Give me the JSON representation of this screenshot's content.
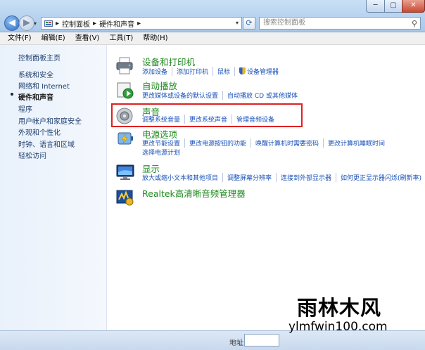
{
  "window": {
    "min_glyph": "─",
    "max_glyph": "▢",
    "close_glyph": "✕"
  },
  "address": {
    "crumbs": [
      "控制面板",
      "硬件和声音"
    ],
    "separator": "▸"
  },
  "search": {
    "placeholder": "搜索控制面板"
  },
  "menubar": [
    "文件(F)",
    "编辑(E)",
    "查看(V)",
    "工具(T)",
    "帮助(H)"
  ],
  "sidebar": {
    "items": [
      {
        "label": "控制面板主页"
      },
      {
        "label": "系统和安全"
      },
      {
        "label": "网络和 Internet"
      },
      {
        "label": "硬件和声音",
        "active": true
      },
      {
        "label": "程序"
      },
      {
        "label": "用户帐户和家庭安全"
      },
      {
        "label": "外观和个性化"
      },
      {
        "label": "时钟、语言和区域"
      },
      {
        "label": "轻松访问"
      }
    ]
  },
  "categories": [
    {
      "title": "设备和打印机",
      "icon": "printer-icon",
      "links": [
        [
          "添加设备",
          "添加打印机",
          "鼠标",
          "设备管理器"
        ]
      ]
    },
    {
      "title": "自动播放",
      "icon": "autoplay-icon",
      "links": [
        [
          "更改媒体或设备的默认设置",
          "自动播放 CD 或其他媒体"
        ]
      ]
    },
    {
      "title": "声音",
      "icon": "speaker-icon",
      "links": [
        [
          "调整系统音量",
          "更改系统声音",
          "管理音频设备"
        ]
      ]
    },
    {
      "title": "电源选项",
      "icon": "battery-icon",
      "links": [
        [
          "更改节能设置",
          "更改电源按钮的功能",
          "唤醒计算机时需要密码",
          "更改计算机睡眠时间"
        ],
        [
          "选择电源计划"
        ]
      ]
    },
    {
      "title": "显示",
      "icon": "monitor-icon",
      "links": [
        [
          "放大或缩小文本和其他项目",
          "调整屏幕分辨率",
          "连接到外部显示器",
          "如何更正显示器闪烁(刷新率)"
        ]
      ]
    },
    {
      "title": "Realtek高清晰音频管理器",
      "icon": "realtek-audio-icon",
      "links": []
    }
  ],
  "status": {
    "address_label": "地址"
  },
  "watermark": {
    "text_cn": "雨林木风",
    "url": "ylmfwin100.com"
  }
}
